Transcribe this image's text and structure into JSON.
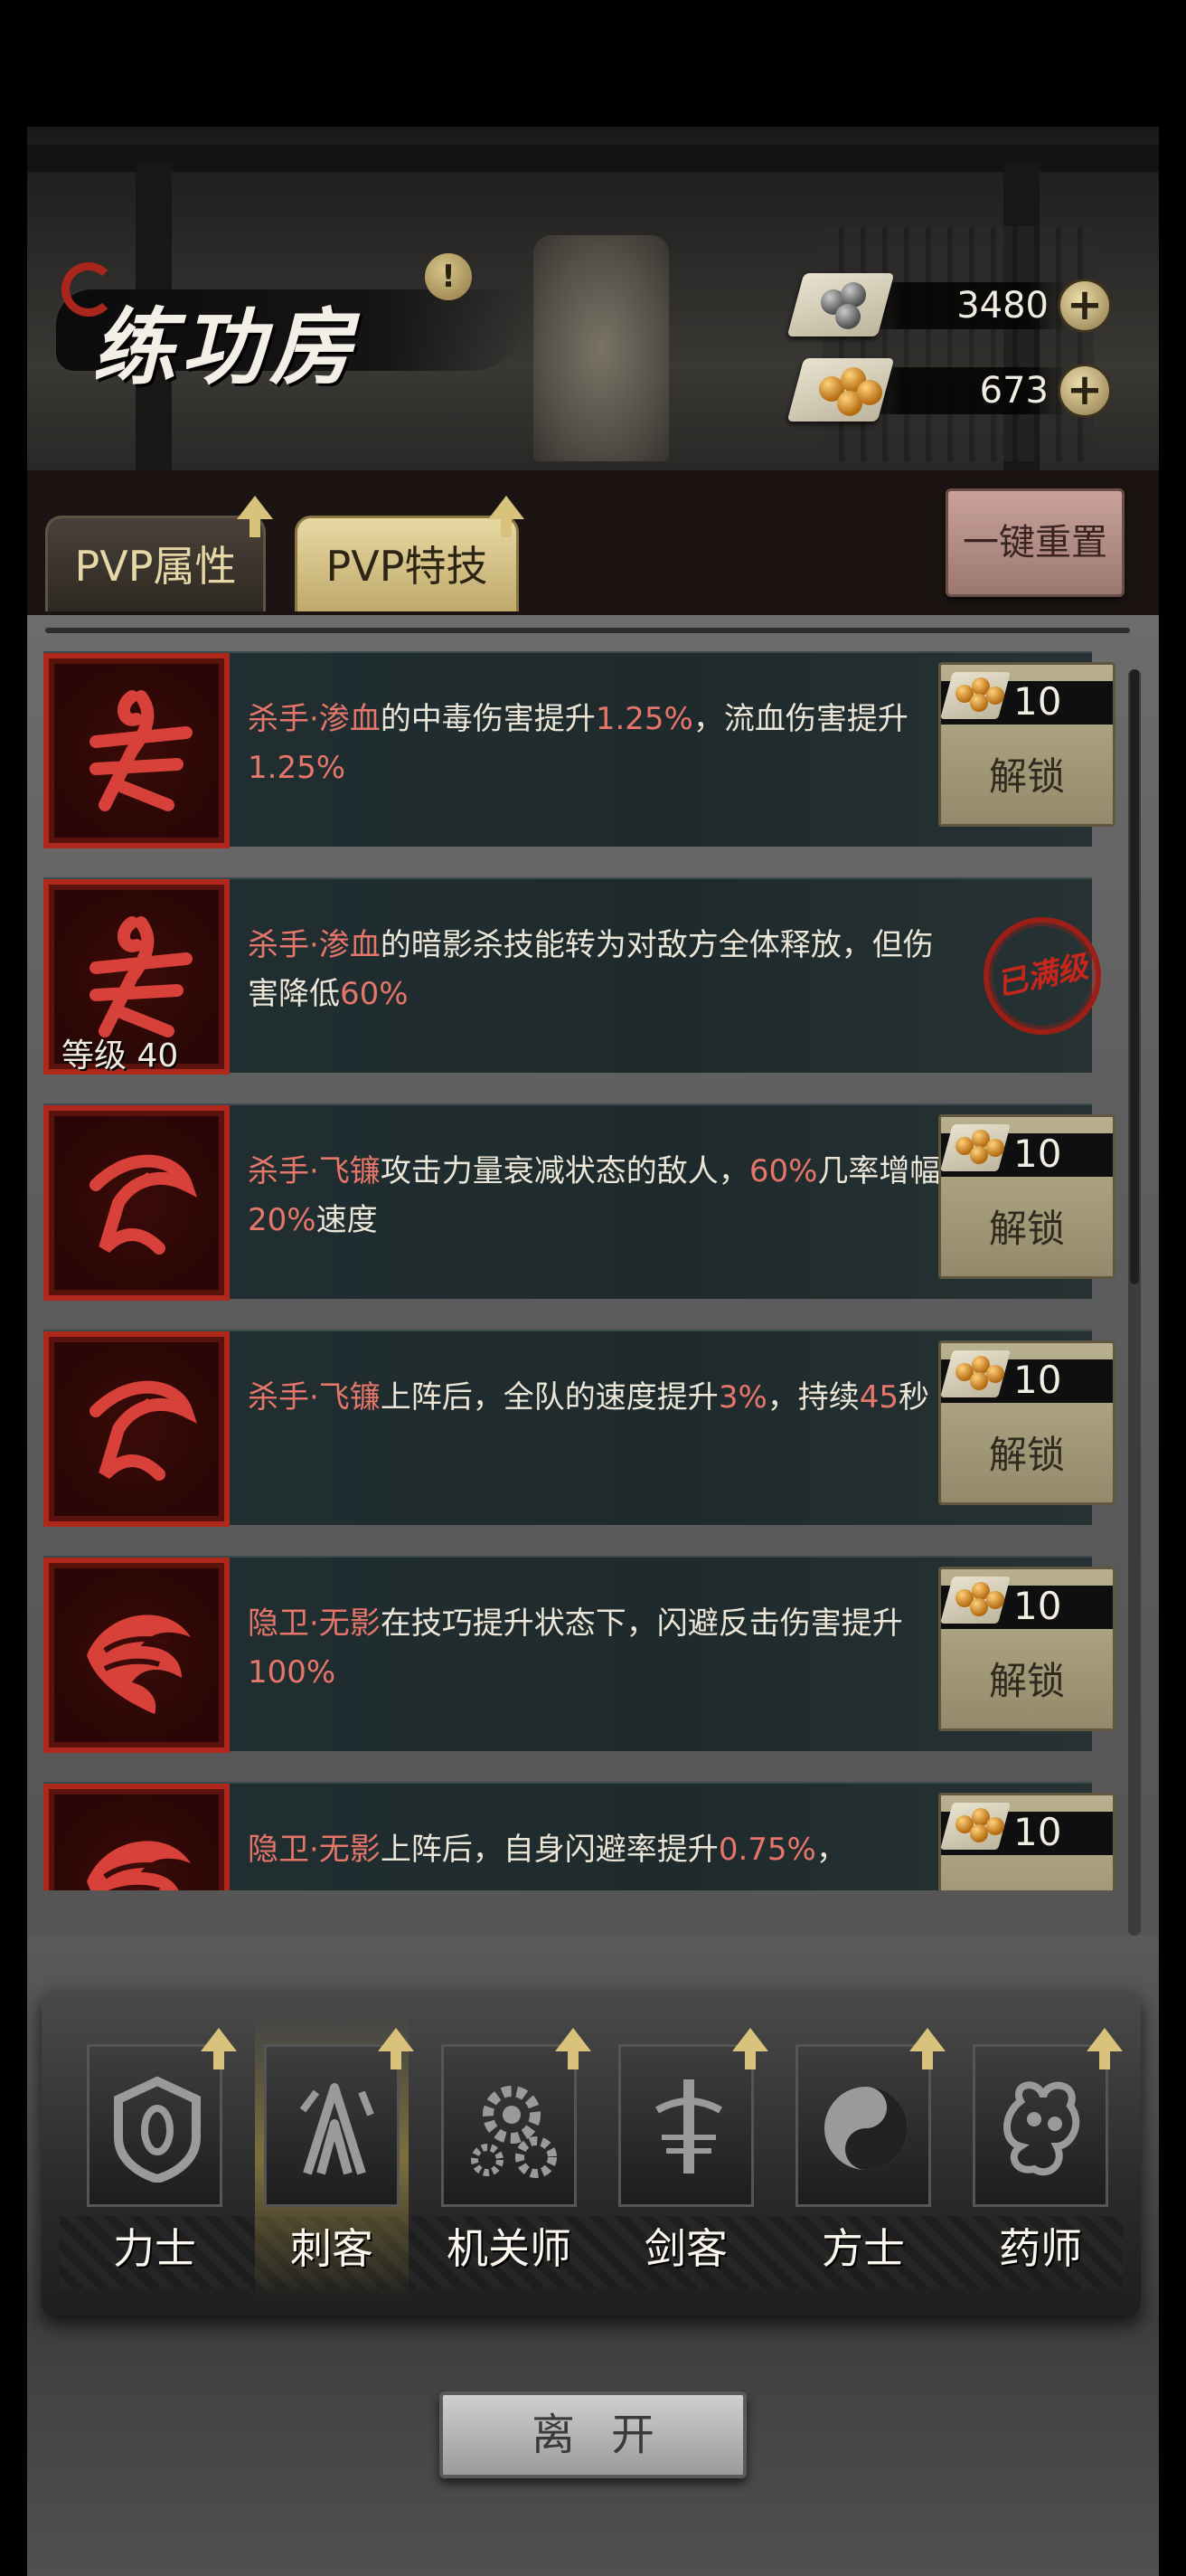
{
  "header": {
    "title": "练功房",
    "currencies": [
      {
        "name": "silver-balls",
        "amount": "3480"
      },
      {
        "name": "gold-balls",
        "amount": "673"
      }
    ]
  },
  "tabs": [
    {
      "label": "PVP属性",
      "active": false
    },
    {
      "label": "PVP特技",
      "active": true
    }
  ],
  "reset_label": "一键重置",
  "skills": [
    {
      "parts": [
        {
          "t": "杀手·渗血",
          "hl": true
        },
        {
          "t": "的中毒伤害提升",
          "hl": false
        },
        {
          "t": "1.25%",
          "hl": true
        },
        {
          "t": "，流血伤害提升",
          "hl": false
        },
        {
          "t": "1.25%",
          "hl": true
        }
      ],
      "cost": "10",
      "action": "解锁",
      "level": "",
      "maxed": false,
      "icon": "claw-icon"
    },
    {
      "parts": [
        {
          "t": "杀手·渗血",
          "hl": true
        },
        {
          "t": "的暗影杀技能转为对敌方全体释放，但伤害降低",
          "hl": false
        },
        {
          "t": "60%",
          "hl": true
        }
      ],
      "cost": "",
      "action": "",
      "level": "等级 40",
      "maxed": true,
      "maxed_label": "已满级",
      "icon": "claw-icon"
    },
    {
      "parts": [
        {
          "t": "杀手·飞镰",
          "hl": true
        },
        {
          "t": "攻击力量衰减状态的敌人，",
          "hl": false
        },
        {
          "t": "60%",
          "hl": true
        },
        {
          "t": "几率增幅",
          "hl": false
        },
        {
          "t": "20%",
          "hl": true
        },
        {
          "t": "速度",
          "hl": false
        }
      ],
      "cost": "10",
      "action": "解锁",
      "level": "",
      "maxed": false,
      "icon": "sickle-icon"
    },
    {
      "parts": [
        {
          "t": "杀手·飞镰",
          "hl": true
        },
        {
          "t": "上阵后，全队的速度提升",
          "hl": false
        },
        {
          "t": "3%",
          "hl": true
        },
        {
          "t": "，持续",
          "hl": false
        },
        {
          "t": "45",
          "hl": true
        },
        {
          "t": "秒",
          "hl": false
        }
      ],
      "cost": "10",
      "action": "解锁",
      "level": "",
      "maxed": false,
      "icon": "sickle-icon"
    },
    {
      "parts": [
        {
          "t": "隐卫·无影",
          "hl": true
        },
        {
          "t": "在技巧提升状态下，闪避反击伤害提升",
          "hl": false
        },
        {
          "t": "100%",
          "hl": true
        }
      ],
      "cost": "10",
      "action": "解锁",
      "level": "",
      "maxed": false,
      "icon": "eagle-icon"
    },
    {
      "parts": [
        {
          "t": "隐卫·无影",
          "hl": true
        },
        {
          "t": "上阵后，自身闪避率提升",
          "hl": false
        },
        {
          "t": "0.75%",
          "hl": true
        },
        {
          "t": "，",
          "hl": false
        }
      ],
      "cost": "10",
      "action": "",
      "level": "",
      "maxed": false,
      "icon": "eagle-icon"
    }
  ],
  "classes": [
    {
      "label": "力士",
      "selected": false,
      "icon": "shield-icon"
    },
    {
      "label": "刺客",
      "selected": true,
      "icon": "claws-icon"
    },
    {
      "label": "机关师",
      "selected": false,
      "icon": "gears-icon"
    },
    {
      "label": "剑客",
      "selected": false,
      "icon": "sword-icon"
    },
    {
      "label": "方士",
      "selected": false,
      "icon": "yinyang-icon"
    },
    {
      "label": "药师",
      "selected": false,
      "icon": "gourd-icon"
    }
  ],
  "leave_label": "离开",
  "colors": {
    "highlight": "#e6766a",
    "icon_border": "#b0281c",
    "tab_active": "#d8c48a"
  }
}
